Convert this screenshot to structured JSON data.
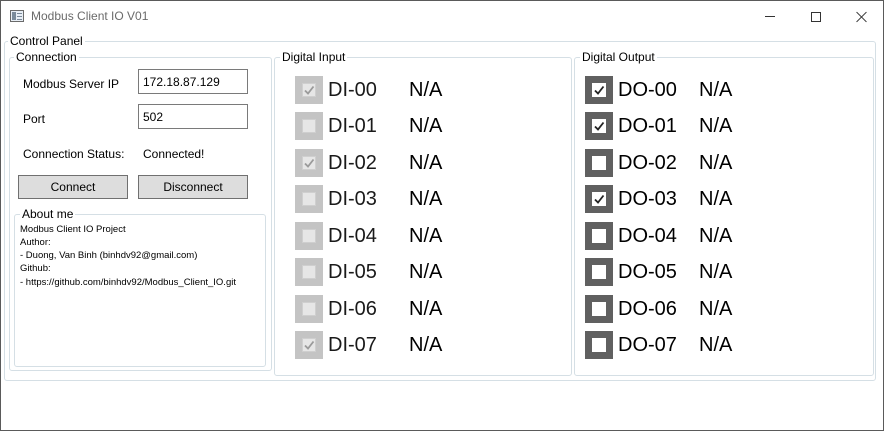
{
  "window": {
    "title": "Modbus Client IO V01"
  },
  "control_panel": {
    "label": "Control Panel"
  },
  "connection": {
    "label": "Connection",
    "server_ip_label": "Modbus Server IP",
    "server_ip_value": "172.18.87.129",
    "port_label": "Port",
    "port_value": "502",
    "status_label": "Connection Status:",
    "status_value": "Connected!",
    "connect_label": "Connect",
    "disconnect_label": "Disconnect"
  },
  "about": {
    "label": "About me",
    "lines": [
      "Modbus Client IO Project",
      "Author:",
      " - Duong, Van Binh (binhdv92@gmail.com)",
      "Github:",
      " - https://github.com/binhdv92/Modbus_Client_IO.git"
    ]
  },
  "digital_input": {
    "label": "Digital Input",
    "items": [
      {
        "name": "DI-00",
        "value": "N/A",
        "checked": true
      },
      {
        "name": "DI-01",
        "value": "N/A",
        "checked": false
      },
      {
        "name": "DI-02",
        "value": "N/A",
        "checked": true
      },
      {
        "name": "DI-03",
        "value": "N/A",
        "checked": false
      },
      {
        "name": "DI-04",
        "value": "N/A",
        "checked": false
      },
      {
        "name": "DI-05",
        "value": "N/A",
        "checked": false
      },
      {
        "name": "DI-06",
        "value": "N/A",
        "checked": false
      },
      {
        "name": "DI-07",
        "value": "N/A",
        "checked": true
      }
    ]
  },
  "digital_output": {
    "label": "Digital Output",
    "items": [
      {
        "name": "DO-00",
        "value": "N/A",
        "checked": true
      },
      {
        "name": "DO-01",
        "value": "N/A",
        "checked": true
      },
      {
        "name": "DO-02",
        "value": "N/A",
        "checked": false
      },
      {
        "name": "DO-03",
        "value": "N/A",
        "checked": true
      },
      {
        "name": "DO-04",
        "value": "N/A",
        "checked": false
      },
      {
        "name": "DO-05",
        "value": "N/A",
        "checked": false
      },
      {
        "name": "DO-06",
        "value": "N/A",
        "checked": false
      },
      {
        "name": "DO-07",
        "value": "N/A",
        "checked": false
      }
    ]
  },
  "colors": {
    "input_checkbox_bg": "#c4c4c4",
    "output_checkbox_bg": "#606060",
    "button_bg": "#dddddd",
    "group_border": "#d5dfe5"
  }
}
